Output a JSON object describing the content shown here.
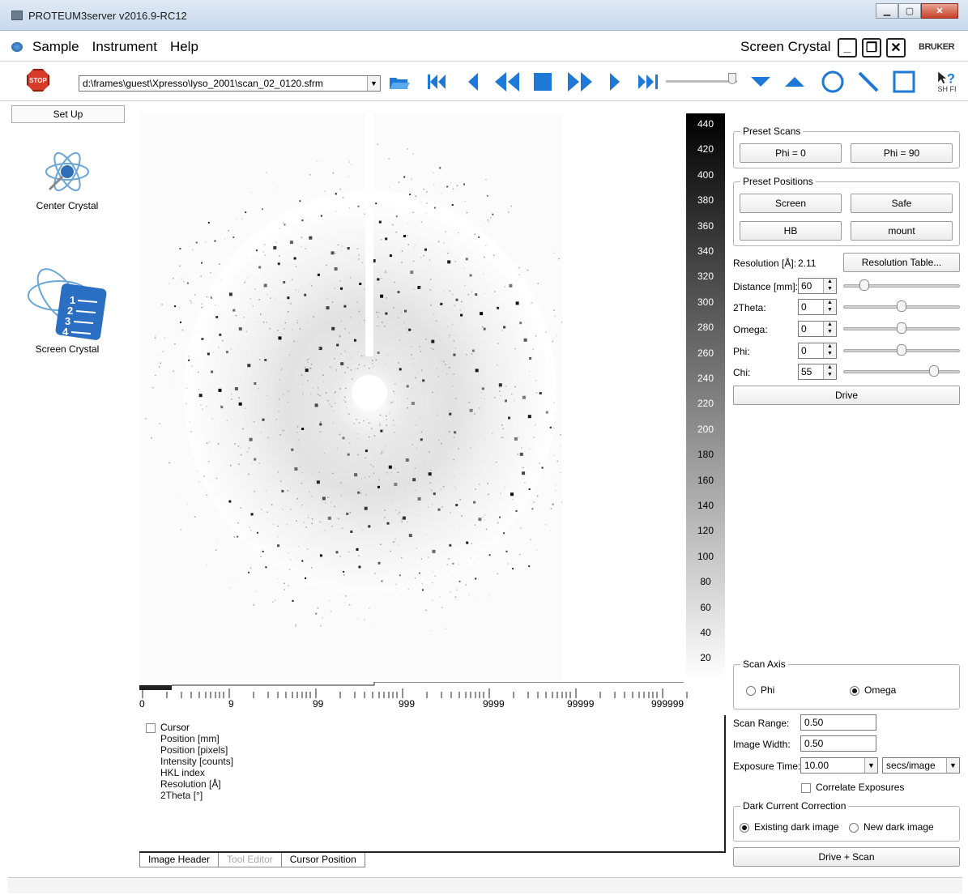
{
  "window": {
    "title": "PROTEUM3server v2016.9-RC12"
  },
  "menubar": {
    "items": [
      "Sample",
      "Instrument",
      "Help"
    ],
    "mode_title": "Screen Crystal",
    "brand": "BRUKER"
  },
  "toolbar": {
    "stop_label": "STOP",
    "frame_path": "d:\\frames\\guest\\Xpresso\\lyso_2001\\scan_02_0120.sfrm",
    "help_label": "SH  FI"
  },
  "left_pane": {
    "setup_label": "Set Up",
    "tasks": [
      "Center Crystal",
      "Screen Crystal"
    ]
  },
  "intensity_scale": {
    "ticks": [
      "440",
      "420",
      "400",
      "380",
      "360",
      "340",
      "320",
      "300",
      "280",
      "260",
      "240",
      "220",
      "200",
      "180",
      "160",
      "140",
      "120",
      "100",
      "80",
      "60",
      "40",
      "20"
    ]
  },
  "bottom_scale": {
    "labels": [
      "0",
      "9",
      "99",
      "999",
      "9999",
      "99999",
      "999999"
    ]
  },
  "info_pane": {
    "root": "Cursor",
    "children": [
      "Position [mm]",
      "Position [pixels]",
      "Intensity [counts]",
      "HKL index",
      "Resolution [Å]",
      "2Theta [°]"
    ]
  },
  "tabs": [
    {
      "label": "Image Header",
      "state": "normal"
    },
    {
      "label": "Tool Editor",
      "state": "disabled"
    },
    {
      "label": "Cursor Position",
      "state": "active"
    }
  ],
  "right_pane": {
    "preset_scans": {
      "title": "Preset Scans",
      "buttons": [
        "Phi = 0",
        "Phi = 90"
      ]
    },
    "preset_positions": {
      "title": "Preset Positions",
      "buttons": [
        "Screen",
        "Safe",
        "HB",
        "mount"
      ]
    },
    "resolution": {
      "label": "Resolution [Å]:",
      "value": "2.11",
      "table_button": "Resolution Table..."
    },
    "axes": [
      {
        "label": "Distance [mm]:",
        "value": "60",
        "slider_level": 0.15
      },
      {
        "label": "2Theta:",
        "value": "0",
        "slider_level": 0.5
      },
      {
        "label": "Omega:",
        "value": "0",
        "slider_level": 0.5
      },
      {
        "label": "Phi:",
        "value": "0",
        "slider_level": 0.5
      },
      {
        "label": "Chi:",
        "value": "55",
        "slider_level": 0.8
      }
    ],
    "drive_button": "Drive",
    "scan_axis": {
      "title": "Scan Axis",
      "options": [
        "Phi",
        "Omega"
      ],
      "selected": "Omega"
    },
    "scan_range": {
      "label": "Scan Range:",
      "value": "0.50"
    },
    "image_width": {
      "label": "Image Width:",
      "value": "0.50"
    },
    "exposure_time": {
      "label": "Exposure Time:",
      "value": "10.00",
      "unit": "secs/image"
    },
    "correlate": {
      "label": "Correlate Exposures",
      "checked": false
    },
    "dark_current": {
      "title": "Dark Current Correction",
      "options": [
        "Existing dark image",
        "New dark image"
      ],
      "selected": "Existing dark image"
    },
    "drive_scan_button": "Drive + Scan"
  },
  "colors": {
    "accent": "#1e78d6",
    "stop": "#d93b2b"
  }
}
